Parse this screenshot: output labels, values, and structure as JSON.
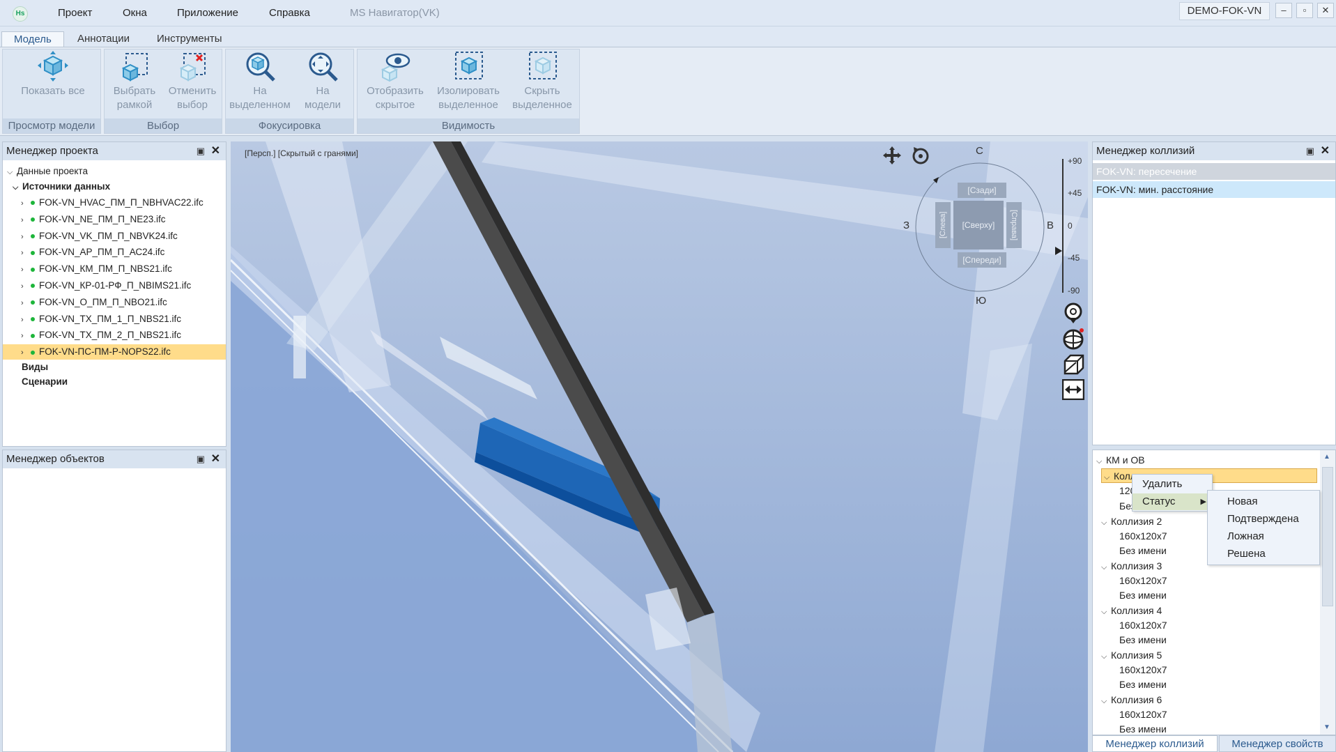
{
  "menubar": {
    "logo": "Hs",
    "items": [
      "Проект",
      "Окна",
      "Приложение",
      "Справка"
    ],
    "app_title": "MS Навигатор(VK)",
    "user": "DEMO-FOK-VN",
    "window_buttons": [
      "–",
      "▫",
      "✕"
    ]
  },
  "ribbon": {
    "tabs": [
      "Модель",
      "Аннотации",
      "Инструменты"
    ],
    "groups": [
      {
        "label": "Просмотр модели",
        "buttons": [
          {
            "line1": "Показать все",
            "line2": ""
          }
        ]
      },
      {
        "label": "Выбор",
        "buttons": [
          {
            "line1": "Выбрать",
            "line2": "рамкой"
          },
          {
            "line1": "Отменить",
            "line2": "выбор"
          }
        ]
      },
      {
        "label": "Фокусировка",
        "buttons": [
          {
            "line1": "На",
            "line2": "выделенном"
          },
          {
            "line1": "На",
            "line2": "модели"
          }
        ]
      },
      {
        "label": "Видимость",
        "buttons": [
          {
            "line1": "Отобразить",
            "line2": "скрытое"
          },
          {
            "line1": "Изолировать",
            "line2": "выделенное"
          },
          {
            "line1": "Скрыть",
            "line2": "выделенное"
          }
        ]
      }
    ]
  },
  "project_manager": {
    "title": "Менеджер проекта",
    "root": "Данные проекта",
    "sources_label": "Источники данных",
    "files": [
      "FOK-VN_HVAC_ПМ_П_NBHVAC22.ifc",
      "FOK-VN_NE_ПМ_П_NE23.ifc",
      "FOK-VN_VK_ПМ_П_NBVK24.ifc",
      "FOK-VN_АР_ПМ_П_АС24.ifc",
      "FOK-VN_КМ_ПМ_П_NBS21.ifc",
      "FOK-VN_КР-01-РФ_П_NBIMS21.ifc",
      "FOK-VN_О_ПМ_П_NBO21.ifc",
      "FOK-VN_ТХ_ПМ_1_П_NBS21.ifc",
      "FOK-VN_ТХ_ПМ_2_П_NBS21.ifc",
      "FOK-VN-ПС-ПМ-Р-NOPS22.ifc"
    ],
    "views_label": "Виды",
    "scenarios_label": "Сценарии"
  },
  "object_manager": {
    "title": "Менеджер объектов"
  },
  "viewport": {
    "mode_label": "[Персп.] [Скрытый с гранями]",
    "compass": {
      "north": "С",
      "south": "Ю",
      "west": "З",
      "east": "В"
    },
    "cube": {
      "back": "[Сзади]",
      "top": "[Сверху]",
      "front": "[Спереди]",
      "left": "[Слева]",
      "right": "[Справа]"
    },
    "angles": [
      "+90",
      "+45",
      "0",
      "-45",
      "-90"
    ]
  },
  "collision_manager": {
    "title": "Менеджер коллизий",
    "tests": [
      "FOK-VN: пересечение",
      "FOK-VN: мин. расстояние"
    ],
    "group": "КМ и ОВ",
    "collision_prefix": "Колл",
    "first_size": "120",
    "first_name": "Без",
    "collisions": [
      {
        "name": "Коллизия 2",
        "size": "160x120x7",
        "label": "Без имени"
      },
      {
        "name": "Коллизия 3",
        "size": "160x120x7",
        "label": "Без имени"
      },
      {
        "name": "Коллизия 4",
        "size": "160x120x7",
        "label": "Без имени"
      },
      {
        "name": "Коллизия 5",
        "size": "160x120x7",
        "label": "Без имени"
      },
      {
        "name": "Коллизия 6",
        "size": "160x120x7",
        "label": "Без имени"
      }
    ],
    "context_menu": {
      "delete": "Удалить",
      "status": "Статус"
    },
    "status_submenu": [
      "Новая",
      "Подтверждена",
      "Ложная",
      "Решена"
    ]
  },
  "bottom_tabs": [
    "Менеджер коллизий",
    "Менеджер свойств"
  ]
}
